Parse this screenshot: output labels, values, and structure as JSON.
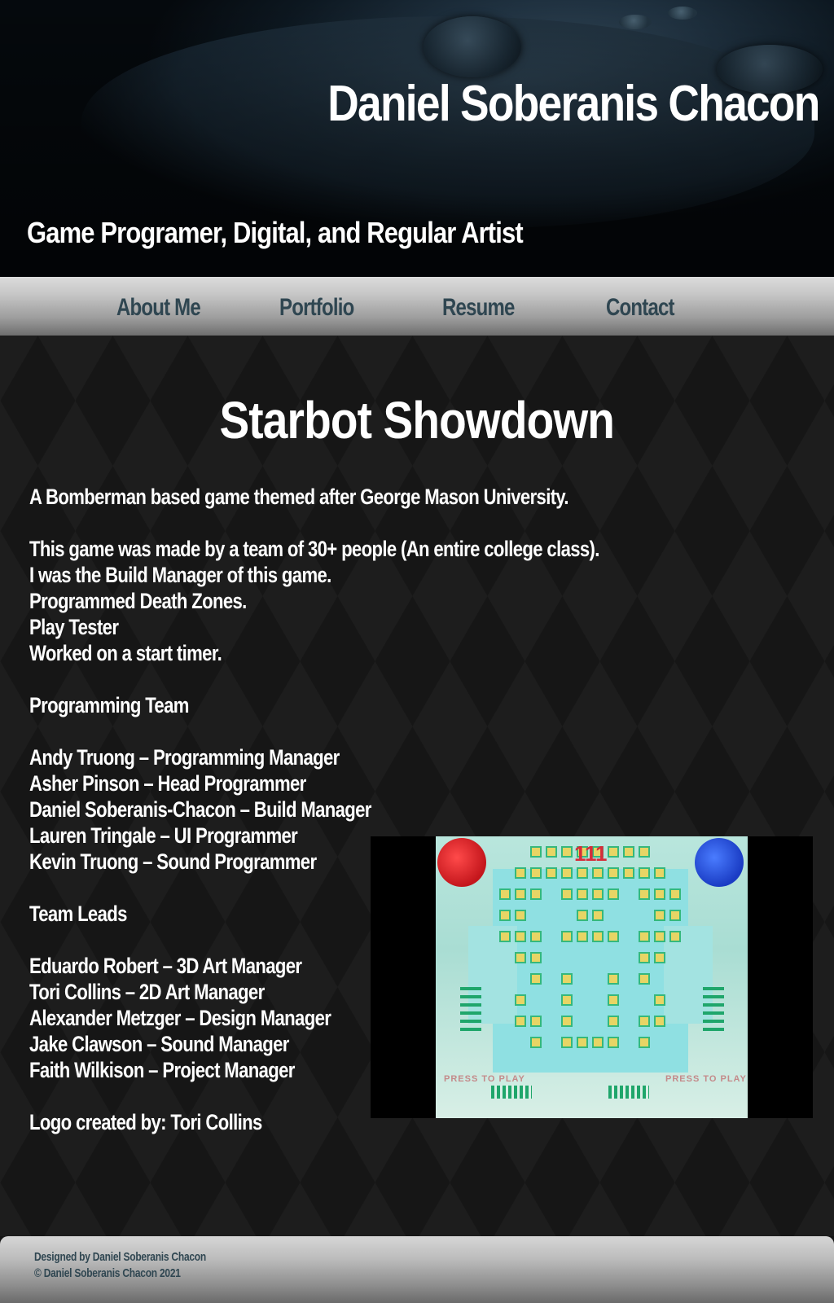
{
  "header": {
    "site_title": "Daniel Soberanis Chacon",
    "tagline": "Game Programer, Digital, and Regular Artist"
  },
  "nav": {
    "items": [
      {
        "label": "About Me"
      },
      {
        "label": "Portfolio"
      },
      {
        "label": "Resume"
      },
      {
        "label": "Contact"
      }
    ]
  },
  "main": {
    "title": "Starbot Showdown",
    "description": "A Bomberman based game themed after George Mason University.",
    "roles": [
      "This game was made by a team of 30+ people (An entire college class).",
      "I was the Build Manager of this game.",
      "Programmed Death Zones.",
      "Play Tester",
      "Worked on a start timer."
    ],
    "programming_team_heading": "Programming Team",
    "programming_team": [
      "Andy Truong – Programming Manager",
      "Asher Pinson – Head Programmer",
      "Daniel Soberanis-Chacon – Build Manager",
      "Lauren Tringale – UI Programmer",
      "Kevin Truong – Sound Programmer"
    ],
    "team_leads_heading": "Team Leads",
    "team_leads": [
      "Eduardo Robert – 3D Art Manager",
      "Tori Collins – 2D Art Manager",
      "Alexander Metzger – Design Manager",
      "Jake Clawson – Sound Manager",
      "Faith Wilkison – Project Manager"
    ],
    "logo_credit": "Logo created by: Tori Collins",
    "game_image": {
      "timer": "111",
      "press_to_play_left": "PRESS TO PLAY",
      "press_to_play_right": "PRESS TO PLAY"
    }
  },
  "footer": {
    "designed_by": "Designed by Daniel Soberanis Chacon",
    "copyright": "© Daniel Soberanis Chacon 2021"
  },
  "colors": {
    "nav_text": "#2f4651",
    "page_text": "#ffffff",
    "background": "#161616"
  }
}
